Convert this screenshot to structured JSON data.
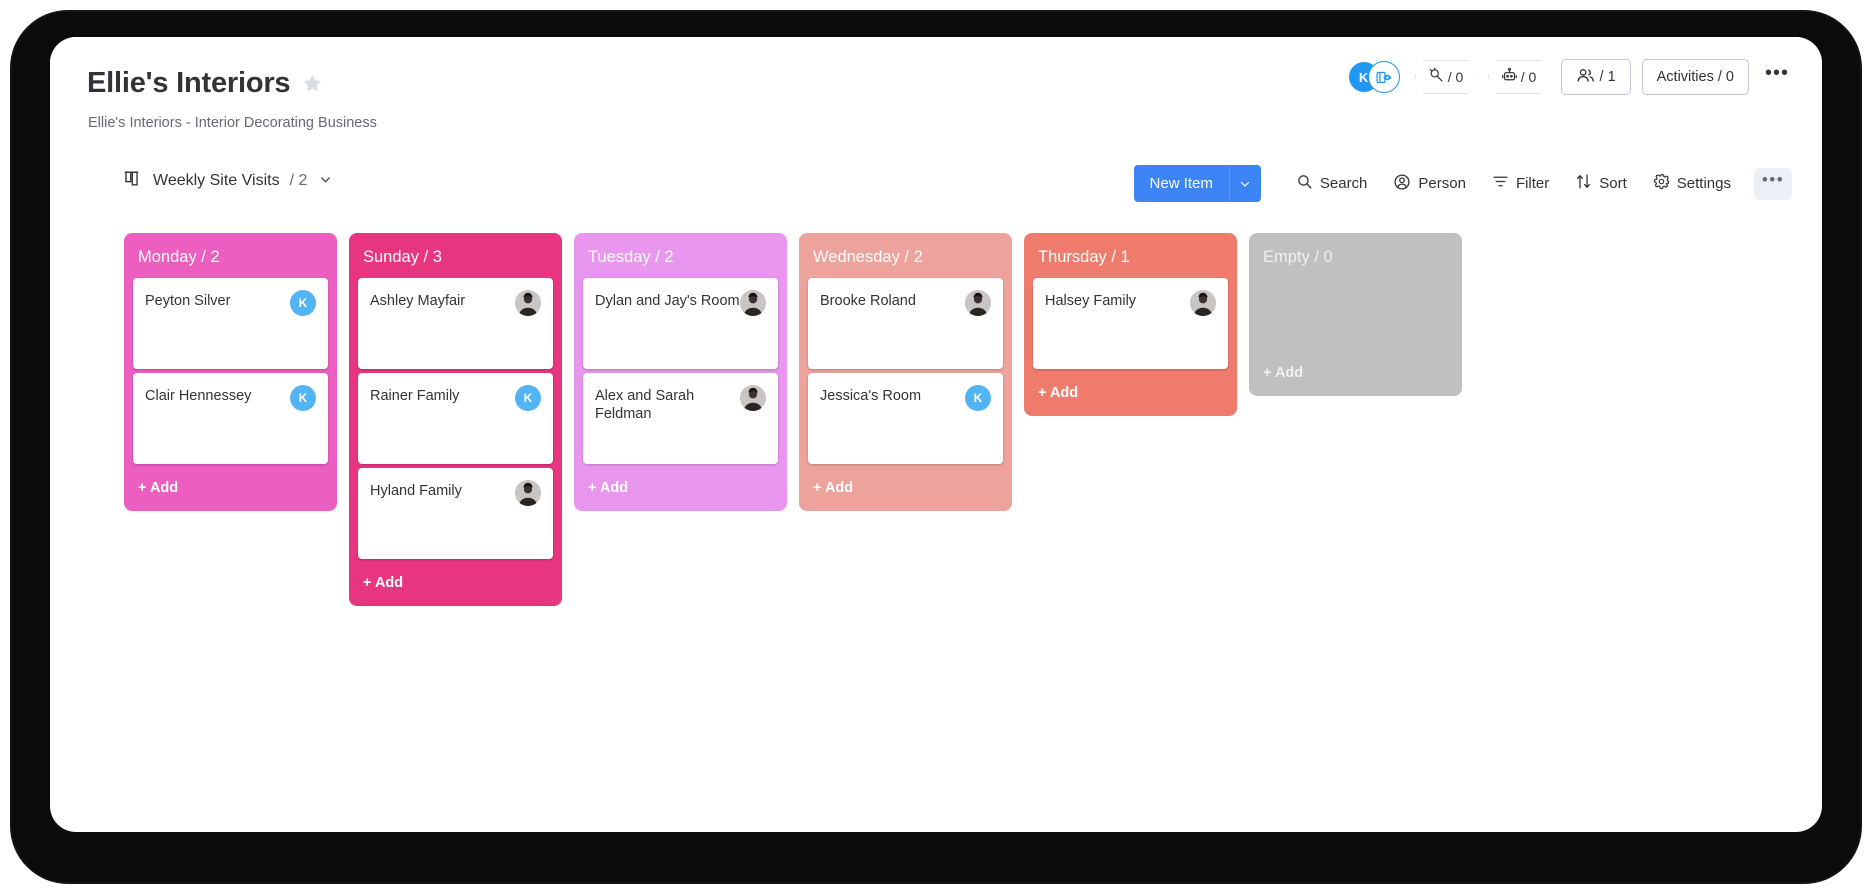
{
  "header": {
    "title": "Ellie's Interiors",
    "subtitle": "Ellie's Interiors - Interior Decorating Business",
    "star_icon": "star-icon",
    "avatar_initial": "K",
    "automations_count": "/ 0",
    "integrations_count": "/ 0",
    "members_label": "/ 1",
    "activities_label": "Activities / 0",
    "more_label": "•••"
  },
  "toolbar": {
    "view_icon": "board-view-icon",
    "view_name": "Weekly Site Visits",
    "view_count": "/ 2",
    "view_chevron": "⌄",
    "new_item_label": "New Item",
    "new_item_arrow": "⌄",
    "search_label": "Search",
    "person_label": "Person",
    "filter_label": "Filter",
    "sort_label": "Sort",
    "settings_label": "Settings",
    "more_label": "•••"
  },
  "board": {
    "add_label": "+ Add",
    "columns": [
      {
        "title": "Monday / 2",
        "color": "#ec5ec0",
        "name": "monday",
        "cards": [
          {
            "title": "Peyton Silver",
            "avatar_type": "initial",
            "avatar": "K"
          },
          {
            "title": "Clair Hennessey",
            "avatar_type": "initial",
            "avatar": "K"
          }
        ]
      },
      {
        "title": "Sunday / 3",
        "color": "#e8357f",
        "name": "sunday",
        "cards": [
          {
            "title": "Ashley Mayfair",
            "avatar_type": "photo",
            "avatar": "person-photo"
          },
          {
            "title": "Rainer Family",
            "avatar_type": "initial",
            "avatar": "K"
          },
          {
            "title": "Hyland Family",
            "avatar_type": "photo",
            "avatar": "person-photo"
          }
        ]
      },
      {
        "title": "Tuesday / 2",
        "color": "#e896ee",
        "name": "tuesday",
        "cards": [
          {
            "title": "Dylan and Jay's Room",
            "avatar_type": "photo",
            "avatar": "person-photo"
          },
          {
            "title": "Alex and Sarah Feldman",
            "avatar_type": "photo",
            "avatar": "person-photo"
          }
        ]
      },
      {
        "title": "Wednesday / 2",
        "color": "#eda29c",
        "name": "wednesday",
        "cards": [
          {
            "title": "Brooke Roland",
            "avatar_type": "photo",
            "avatar": "person-photo"
          },
          {
            "title": "Jessica's Room",
            "avatar_type": "initial",
            "avatar": "K"
          }
        ]
      },
      {
        "title": "Thursday / 1",
        "color": "#ee7b6b",
        "name": "thursday",
        "cards": [
          {
            "title": "Halsey Family",
            "avatar_type": "photo",
            "avatar": "person-photo"
          }
        ]
      },
      {
        "title": "Empty / 0",
        "color": "#c0c0c0",
        "name": "empty",
        "cards": []
      }
    ]
  }
}
